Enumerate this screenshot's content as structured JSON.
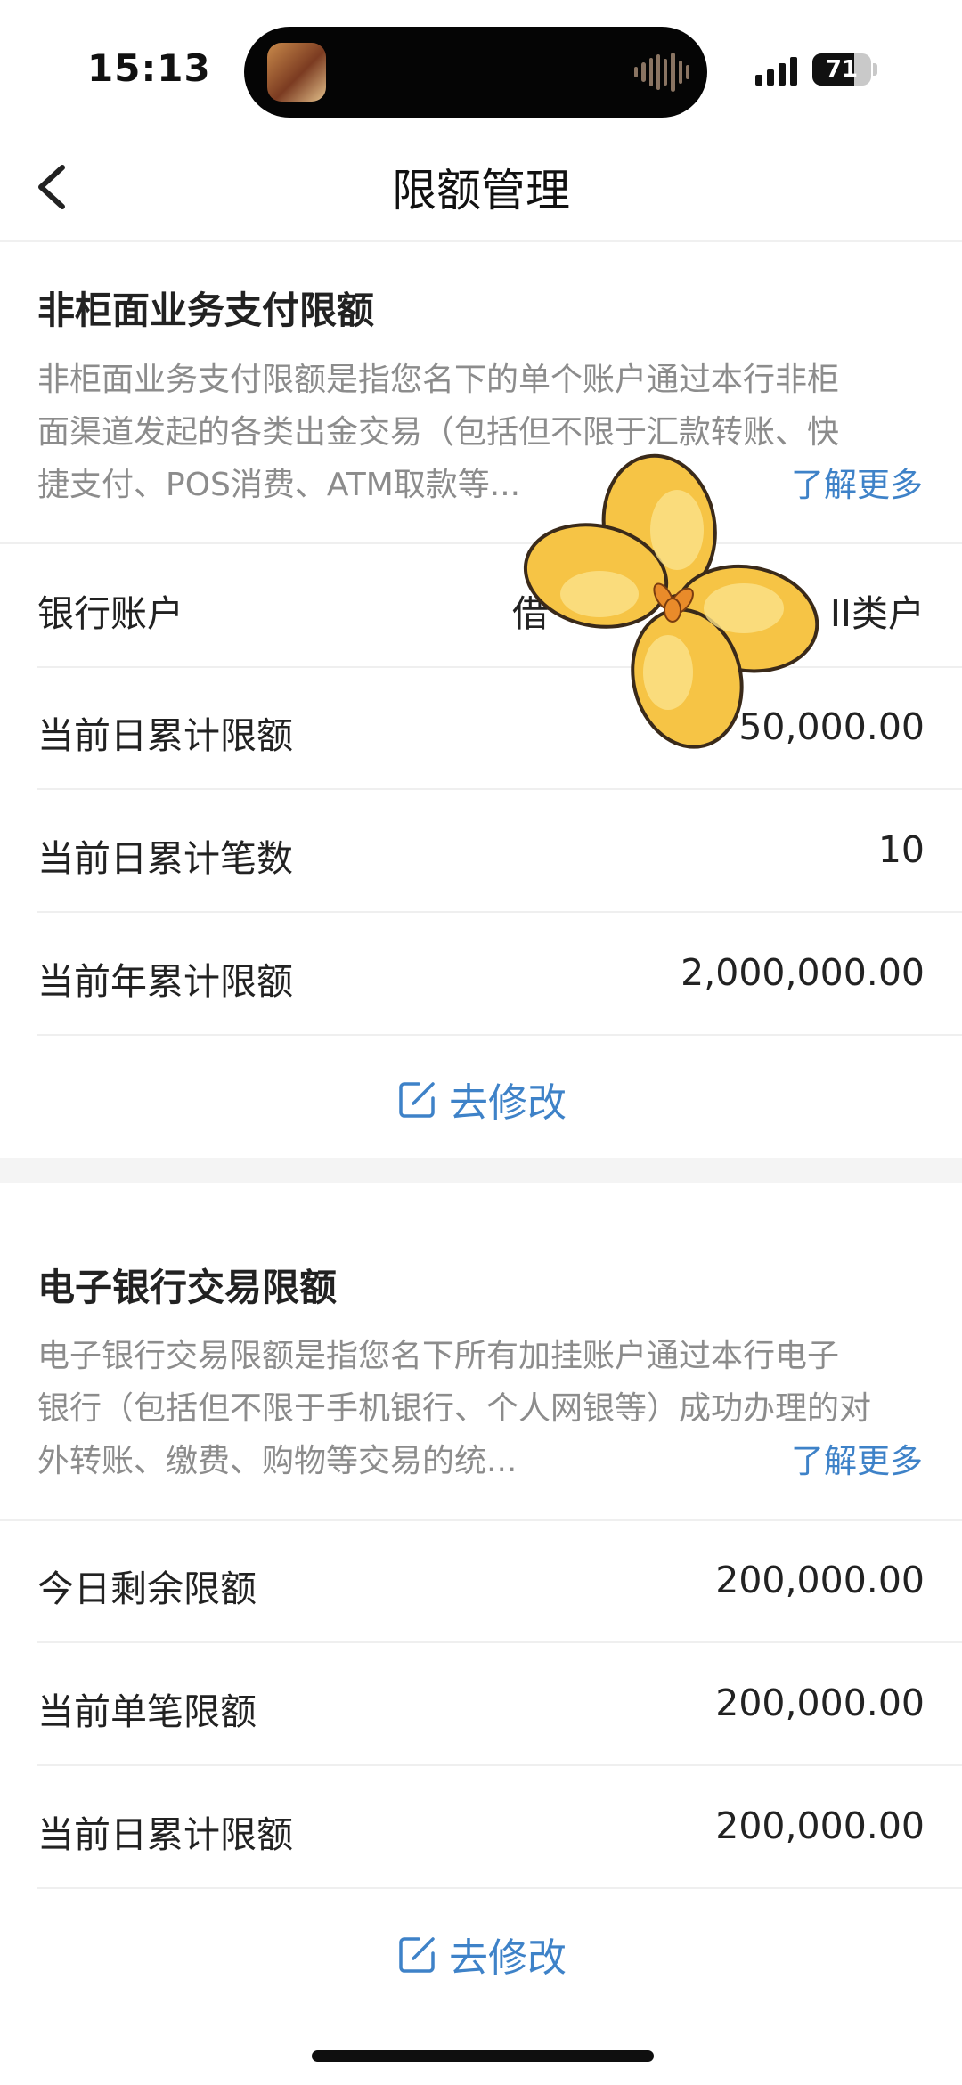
{
  "status_bar": {
    "time": "15:13",
    "battery": "71",
    "battery_level": 0.71
  },
  "nav": {
    "title": "限额管理",
    "back_icon": "chevron-left-icon"
  },
  "section1": {
    "title": "非柜面业务支付限额",
    "description_line1": "非柜面业务支付限额是指您名下的单个账户通过本行非柜",
    "description_line2": "面渠道发起的各类出金交易（包括但不限于汇款转账、快",
    "description_line3": "捷支付、POS消费、ATM取款等...",
    "more_link": "了解更多",
    "rows": [
      {
        "label": "银行账户",
        "value_left": "借",
        "value": "II类户"
      },
      {
        "label": "当前日累计限额",
        "value": "50,000.00"
      },
      {
        "label": "当前日累计笔数",
        "value": "10"
      },
      {
        "label": "当前年累计限额",
        "value": "2,000,000.00"
      }
    ],
    "edit_label": "去修改",
    "edit_icon": "edit-icon"
  },
  "section2": {
    "title": "电子银行交易限额",
    "description_line1": "电子银行交易限额是指您名下所有加挂账户通过本行电子",
    "description_line2": "银行（包括但不限于手机银行、个人网银等）成功办理的对",
    "description_line3": "外转账、缴费、购物等交易的统...",
    "more_link": "了解更多",
    "rows": [
      {
        "label": "今日剩余限额",
        "value": "200,000.00"
      },
      {
        "label": "当前单笔限额",
        "value": "200,000.00"
      },
      {
        "label": "当前日累计限额",
        "value": "200,000.00"
      }
    ],
    "edit_label": "去修改",
    "edit_icon": "edit-icon"
  },
  "colors": {
    "accent": "#3e82c8",
    "sticker": "#f6c445"
  },
  "overlay": {
    "sticker_icon": "four-petal-flower-sticker"
  }
}
